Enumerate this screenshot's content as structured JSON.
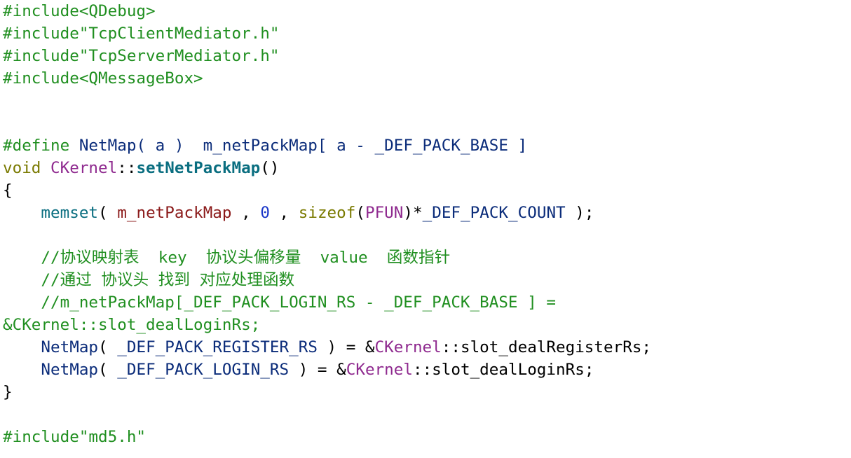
{
  "colors": {
    "preprocessor": "#208f20",
    "macro": "#0b2c7a",
    "text": "#000000",
    "keyword": "#7a7a00",
    "class_name": "#8f2a8f",
    "member": "#8b1a1a",
    "function_def": "#0a6e80",
    "number": "#1a36c8",
    "comment": "#208f20"
  },
  "lines": [
    [
      {
        "t": "#include<QDebug>",
        "c": "green"
      }
    ],
    [
      {
        "t": "#include\"TcpClientMediator.h\"",
        "c": "green"
      }
    ],
    [
      {
        "t": "#include\"TcpServerMediator.h\"",
        "c": "green"
      }
    ],
    [
      {
        "t": "#include<QMessageBox>",
        "c": "green"
      }
    ],
    [],
    [],
    [
      {
        "t": "#define ",
        "c": "green"
      },
      {
        "t": "NetMap( a )  m_netPackMap[ a - _DEF_PACK_BASE ]",
        "c": "navy"
      }
    ],
    [
      {
        "t": "void ",
        "c": "olive"
      },
      {
        "t": "CKernel",
        "c": "purple"
      },
      {
        "t": "::",
        "c": "black"
      },
      {
        "t": "setNetPackMap",
        "c": "teal"
      },
      {
        "t": "()",
        "c": "black"
      }
    ],
    [
      {
        "t": "{",
        "c": "black"
      }
    ],
    [
      {
        "t": "    ",
        "c": "black"
      },
      {
        "t": "memset",
        "c": "teal-plain"
      },
      {
        "t": "( ",
        "c": "black"
      },
      {
        "t": "m_netPackMap",
        "c": "maroon"
      },
      {
        "t": " , ",
        "c": "black"
      },
      {
        "t": "0",
        "c": "blue"
      },
      {
        "t": " , ",
        "c": "black"
      },
      {
        "t": "sizeof",
        "c": "olive"
      },
      {
        "t": "(",
        "c": "black"
      },
      {
        "t": "PFUN",
        "c": "purple"
      },
      {
        "t": ")*",
        "c": "black"
      },
      {
        "t": "_DEF_PACK_COUNT",
        "c": "navy"
      },
      {
        "t": " );",
        "c": "black"
      }
    ],
    [],
    [
      {
        "t": "    //协议映射表  key  协议头偏移量  value  函数指针",
        "c": "comment"
      }
    ],
    [
      {
        "t": "    //通过 协议头 找到 对应处理函数",
        "c": "comment"
      }
    ],
    [
      {
        "t": "    //m_netPackMap[_DEF_PACK_LOGIN_RS - _DEF_PACK_BASE ] =",
        "c": "comment"
      }
    ],
    [
      {
        "t": "&CKernel::slot_dealLoginRs;",
        "c": "comment"
      }
    ],
    [
      {
        "t": "    ",
        "c": "black"
      },
      {
        "t": "NetMap",
        "c": "navy"
      },
      {
        "t": "( ",
        "c": "black"
      },
      {
        "t": "_DEF_PACK_REGISTER_RS",
        "c": "navy"
      },
      {
        "t": " ) = &",
        "c": "black"
      },
      {
        "t": "CKernel",
        "c": "purple"
      },
      {
        "t": "::slot_dealRegisterRs;",
        "c": "black"
      }
    ],
    [
      {
        "t": "    ",
        "c": "black"
      },
      {
        "t": "NetMap",
        "c": "navy"
      },
      {
        "t": "( ",
        "c": "black"
      },
      {
        "t": "_DEF_PACK_LOGIN_RS",
        "c": "navy"
      },
      {
        "t": " ) = &",
        "c": "black"
      },
      {
        "t": "CKernel",
        "c": "purple"
      },
      {
        "t": "::slot_dealLoginRs;",
        "c": "black"
      }
    ],
    [
      {
        "t": "}",
        "c": "black"
      }
    ],
    [],
    [
      {
        "t": "#include\"md5.h\"",
        "c": "green"
      }
    ]
  ]
}
